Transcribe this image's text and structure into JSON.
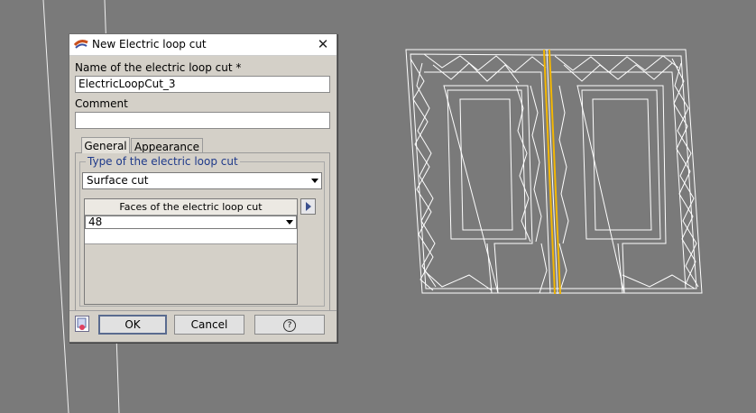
{
  "dialog": {
    "title": "New Electric loop cut",
    "close_glyph": "✕",
    "name_label": "Name of the electric loop cut *",
    "name_value": "ElectricLoopCut_3",
    "comment_label": "Comment",
    "comment_value": "",
    "tabs": [
      {
        "label": "General",
        "active": true
      },
      {
        "label": "Appearance",
        "active": false
      }
    ],
    "group_label": "Type of the electric loop cut",
    "type_selected": "Surface cut",
    "faces_header": "Faces of the electric loop cut",
    "faces_selected": "48",
    "buttons": {
      "ok": "OK",
      "cancel": "Cancel",
      "help_glyph": "?"
    }
  },
  "icons": {
    "title": "loop-cut-app-icon",
    "close": "close-icon",
    "add_face": "arrow-right-icon",
    "bottom_left": "dialog-options-icon",
    "help": "help-icon"
  },
  "colors": {
    "viewport_bg": "#7a7a7a",
    "mesh_lines": "#ffffff",
    "cut_highlight": "#f2b705",
    "group_label": "#1f3a8a"
  }
}
